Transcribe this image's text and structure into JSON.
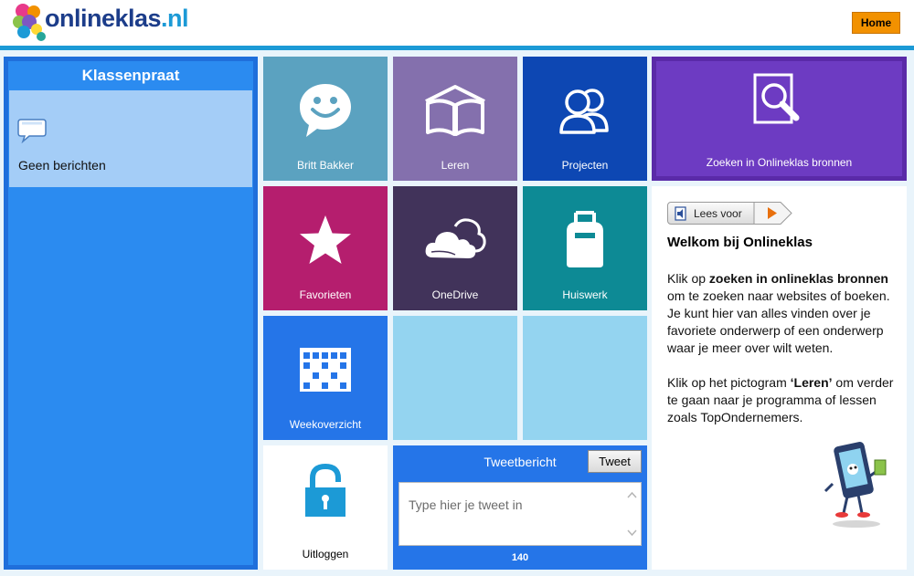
{
  "header": {
    "logo_main": "onlineklas",
    "logo_tld": ".nl",
    "home_label": "Home"
  },
  "klassenpraat": {
    "title": "Klassenpraat",
    "empty_message": "Geen berichten"
  },
  "tiles": [
    {
      "label": "Britt Bakker",
      "icon": "smiley-speech-icon",
      "color": "#5ba2c0"
    },
    {
      "label": "Leren",
      "icon": "book-icon",
      "color": "#8470ad"
    },
    {
      "label": "Projecten",
      "icon": "people-icon",
      "color": "#0d47b3"
    },
    {
      "label": "Favorieten",
      "icon": "star-icon",
      "color": "#b51e6e"
    },
    {
      "label": "OneDrive",
      "icon": "cloud-icon",
      "color": "#41335a"
    },
    {
      "label": "Huiswerk",
      "icon": "backpack-icon",
      "color": "#0d8a95"
    },
    {
      "label": "Weekoverzicht",
      "icon": "calendar-icon",
      "color": "#2575e8"
    }
  ],
  "empty_tile_color": "#94d4f0",
  "search_tile": {
    "label": "Zoeken in Onlineklas bronnen",
    "icon": "search-document-icon",
    "color": "#6d3bc2"
  },
  "welcome": {
    "read_aloud": "Lees voor",
    "heading": "Welkom bij Onlineklas",
    "p1_pre": "Klik op ",
    "p1_bold": "zoeken in onlineklas bronnen",
    "p1_post": " om te zoeken naar websites of boeken. Je kunt hier van alles vinden over je favoriete onderwerp of een onderwerp waar je meer over wilt weten.",
    "p2_pre": "Klik op het pictogram ",
    "p2_bold": "‘Leren’",
    "p2_post": " om verder te gaan naar je programma of lessen zoals TopOndernemers."
  },
  "logout": {
    "label": "Uitloggen",
    "icon": "padlock-icon"
  },
  "tweet": {
    "title": "Tweetbericht",
    "button": "Tweet",
    "placeholder": "Type hier je tweet in",
    "counter": "140"
  }
}
